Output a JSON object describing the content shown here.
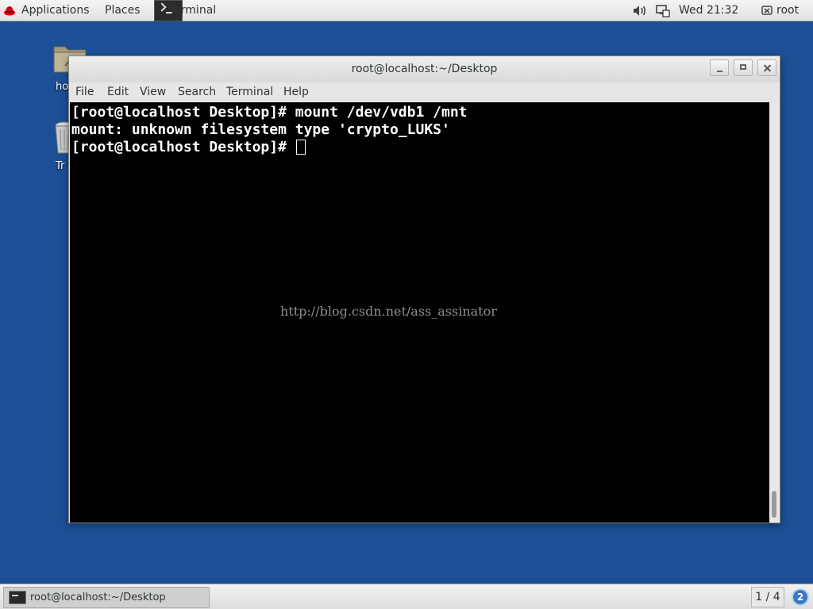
{
  "top_panel": {
    "applications_label": "Applications",
    "places_label": "Places",
    "terminal_label": "Terminal",
    "clock": "Wed 21:32",
    "user": "root",
    "icons": [
      "redhat-icon",
      "terminal-app-icon",
      "volume-icon",
      "network-icon",
      "user-icon"
    ]
  },
  "desktop": {
    "home_label": "ho",
    "trash_label": "Tr"
  },
  "window": {
    "title": "root@localhost:~/Desktop",
    "menu": [
      "File",
      "Edit",
      "View",
      "Search",
      "Terminal",
      "Help"
    ]
  },
  "terminal": {
    "lines": [
      "[root@localhost Desktop]# mount /dev/vdb1 /mnt",
      "mount: unknown filesystem type 'crypto_LUKS'",
      "[root@localhost Desktop]# "
    ],
    "watermark": "http://blog.csdn.net/ass_assinator"
  },
  "bottom_panel": {
    "task_label": "root@localhost:~/Desktop",
    "workspace": "1 / 4",
    "notification_count": "2"
  },
  "colors": {
    "desktop_bg": "#1c4f95",
    "terminal_bg": "#000000",
    "terminal_fg": "#ffffff"
  }
}
